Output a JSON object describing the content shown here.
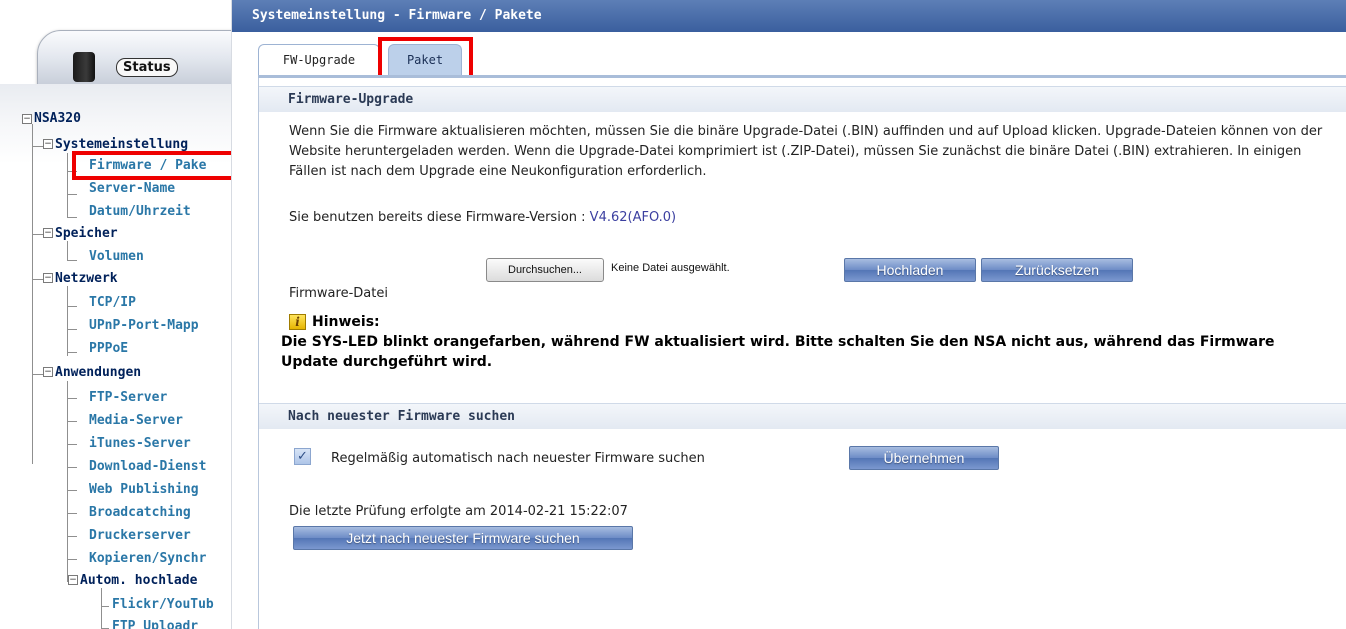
{
  "sidebar": {
    "status_label": "Status",
    "tree": {
      "root": "NSA320",
      "categories": {
        "system": "Systemeinstellung",
        "storage": "Speicher",
        "network": "Netzwerk",
        "apps": "Anwendungen",
        "auto_upload": "Autom. hochlade"
      },
      "leaves": {
        "firmware": "Firmware / Pake",
        "server_name": "Server-Name",
        "datetime": "Datum/Uhrzeit",
        "volume": "Volumen",
        "tcpip": "TCP/IP",
        "upnp": "UPnP-Port-Mapp",
        "pppoe": "PPPoE",
        "ftp": "FTP-Server",
        "media": "Media-Server",
        "itunes": "iTunes-Server",
        "download": "Download-Dienst",
        "webpub": "Web Publishing",
        "broadcatching": "Broadcatching",
        "printer": "Druckerserver",
        "copy": "Kopieren/Synchr",
        "flickr": "Flickr/YouTub",
        "ftpupload": "FTP Uploadr"
      }
    }
  },
  "main": {
    "title": "Systemeinstellung - Firmware / Pakete",
    "tabs": {
      "fw": "FW-Upgrade",
      "paket": "Paket"
    },
    "upgrade": {
      "header": "Firmware-Upgrade",
      "description": "Wenn Sie die Firmware aktualisieren möchten, müssen Sie die binäre Upgrade-Datei (.BIN) auffinden und auf Upload klicken. Upgrade-Dateien können von der Website heruntergeladen werden. Wenn die Upgrade-Datei komprimiert ist (.ZIP-Datei), müssen Sie zunächst die binäre Datei (.BIN) extrahieren. In einigen Fällen ist nach dem Upgrade eine Neukonfiguration erforderlich.",
      "version_text": "Sie benutzen bereits diese Firmware-Version : ",
      "version_value": "V4.62(AFO.0)",
      "file_label": "Firmware-Datei",
      "browse_label": "Durchsuchen...",
      "no_file": "Keine Datei ausgewählt.",
      "upload_label": "Hochladen",
      "reset_label": "Zurücksetzen",
      "hint_title": "Hinweis:",
      "hint_text": "Die SYS-LED blinkt orangefarben, während FW aktualisiert wird. Bitte schalten Sie den NSA nicht aus, während das Firmware Update durchgeführt wird."
    },
    "search": {
      "header": "Nach neuester Firmware suchen",
      "auto_label": "Regelmäßig automatisch nach neuester Firmware suchen",
      "auto_checked": true,
      "apply_label": "Übernehmen",
      "last_check": "Die letzte Prüfung erfolgte am 2014-02-21 15:22:07",
      "check_now_label": "Jetzt nach neuester Firmware suchen"
    }
  },
  "colors": {
    "title_bar": "#3a5f9e",
    "highlight": "#ee0000",
    "leaf_link": "#2a77a7",
    "category": "#00215a",
    "button_blue": "#6d8cc6"
  }
}
